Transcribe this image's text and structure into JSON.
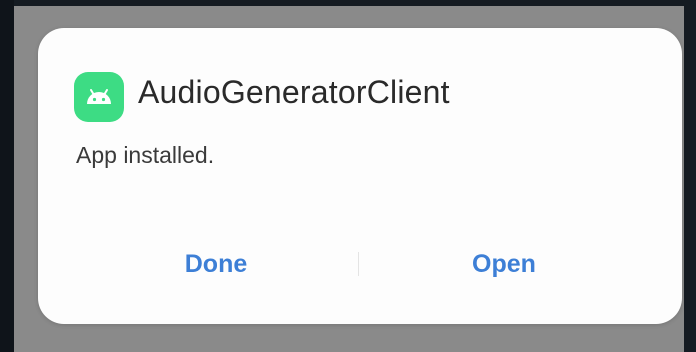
{
  "dialog": {
    "app_name": "AudioGeneratorClient",
    "message": "App installed.",
    "app_icon": "android-icon",
    "icon_color": "#3ddc84"
  },
  "actions": {
    "done_label": "Done",
    "open_label": "Open",
    "accent_color": "#3d7fd6"
  }
}
